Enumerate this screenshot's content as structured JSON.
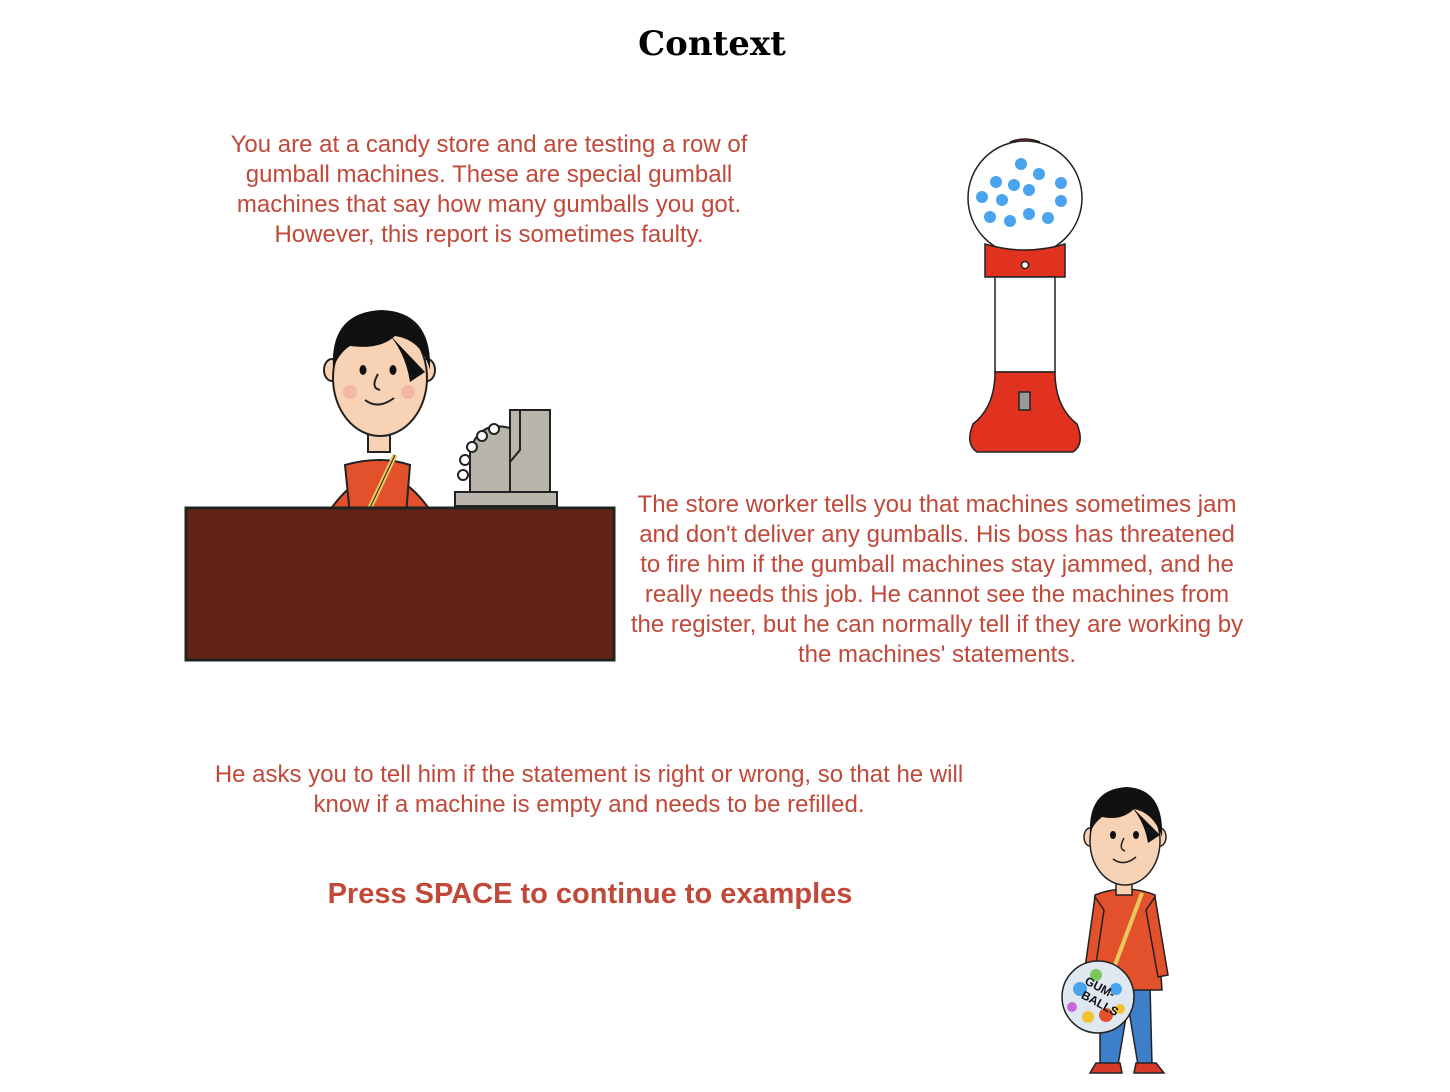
{
  "page": {
    "title": "Context",
    "paragraphs": {
      "intro": "You are at a candy store and are testing a row of gumball machines. These are special gumball machines that say how many gumballs you got. However, this report is sometimes faulty.",
      "worker": "The store worker tells you that machines sometimes jam and don't deliver any gumballs. His boss has threatened to fire him if the gumball machines stay jammed, and he really needs this job. He cannot see the machines from the register, but he can normally tell if they are working by the machines' statements.",
      "request": "He asks you to tell him if the statement is right or wrong, so that he will know if a machine is empty and needs to be refilled."
    },
    "continue_prompt": "Press SPACE to continue to examples"
  },
  "illustrations": {
    "cashier": "cashier-at-counter-illustration",
    "gumball_machine": "gumball-machine-illustration",
    "boy": "boy-with-gumballs-illustration",
    "bag_label": "GUM-BALLS"
  },
  "colors": {
    "text_accent": "#c0493a",
    "counter": "#632416",
    "gumball": "#4aa3ee",
    "machine_red": "#e0321f",
    "shirt": "#e3502c",
    "jeans": "#3d7fc9"
  }
}
